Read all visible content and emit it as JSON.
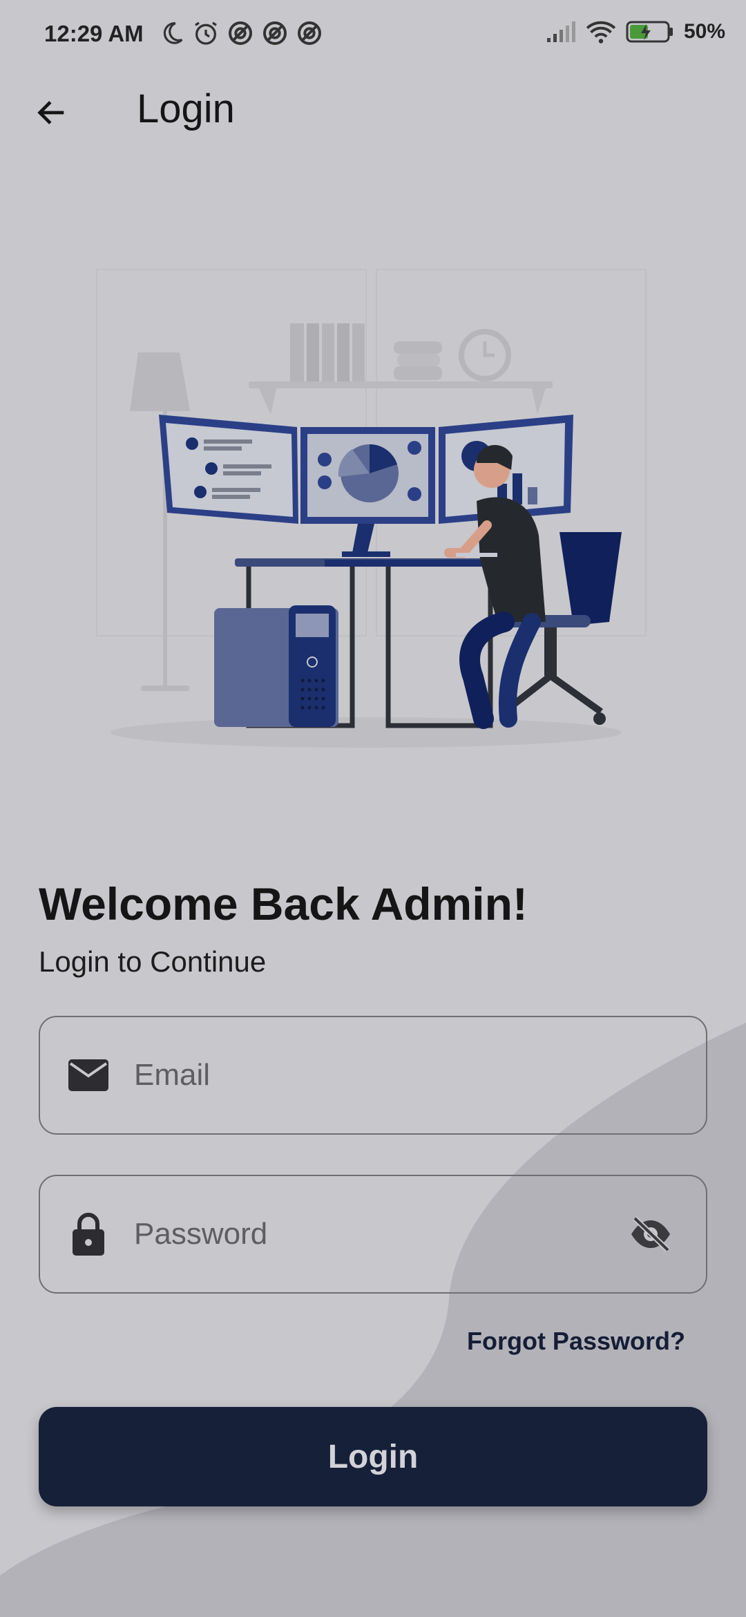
{
  "status_bar": {
    "time": "12:29 AM",
    "battery_percent": "50%",
    "icons": [
      "moon-icon",
      "alarm-icon",
      "notification-icon",
      "notification-icon",
      "notification-icon",
      "signal-icon",
      "wifi-icon",
      "battery-icon"
    ]
  },
  "app_bar": {
    "title": "Login",
    "back_icon": "arrow-left-icon"
  },
  "illustration": "person-at-desk-with-monitors",
  "welcome": {
    "heading": "Welcome Back Admin!",
    "subtitle": "Login to Continue"
  },
  "form": {
    "email_placeholder": "Email",
    "email_value": "",
    "email_icon": "mail-icon",
    "password_placeholder": "Password",
    "password_value": "",
    "password_icon": "lock-icon",
    "password_toggle_icon": "eye-off-icon",
    "forgot_label": "Forgot Password?",
    "login_label": "Login"
  },
  "colors": {
    "background": "#c8c7cc",
    "primary_button": "#172039",
    "accent_navy": "#0f2366"
  }
}
